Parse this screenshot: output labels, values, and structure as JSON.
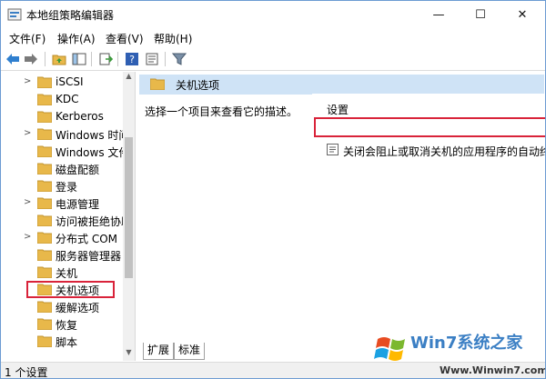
{
  "window": {
    "title": "本地组策略编辑器",
    "controls": {
      "minimize": "—",
      "maximize": "☐",
      "close": "✕"
    }
  },
  "menu": [
    "文件(F)",
    "操作(A)",
    "查看(V)",
    "帮助(H)"
  ],
  "toolbar": [
    "back-icon",
    "forward-icon",
    "up-folder-icon",
    "show-hide-tree-icon",
    "export-list-icon",
    "help-icon",
    "properties-icon",
    "filter-icon"
  ],
  "tree": {
    "items": [
      {
        "label": "iSCSI",
        "expandable": true
      },
      {
        "label": "KDC",
        "expandable": false
      },
      {
        "label": "Kerberos",
        "expandable": false
      },
      {
        "label": "Windows 时间",
        "expandable": true
      },
      {
        "label": "Windows 文件",
        "expandable": false
      },
      {
        "label": "磁盘配额",
        "expandable": false
      },
      {
        "label": "登录",
        "expandable": false
      },
      {
        "label": "电源管理",
        "expandable": true
      },
      {
        "label": "访问被拒绝协助",
        "expandable": false
      },
      {
        "label": "分布式 COM",
        "expandable": true
      },
      {
        "label": "服务器管理器",
        "expandable": false
      },
      {
        "label": "关机",
        "expandable": false
      },
      {
        "label": "关机选项",
        "expandable": false,
        "selected": true
      },
      {
        "label": "缓解选项",
        "expandable": false
      },
      {
        "label": "恢复",
        "expandable": false
      },
      {
        "label": "脚本",
        "expandable": false
      }
    ]
  },
  "pane": {
    "title": "关机选项",
    "description": "选择一个项目来查看它的描述。",
    "column_header": "设置",
    "rows": [
      "关闭会阻止或取消关机的应用程序的自动终止"
    ]
  },
  "tabs": [
    "扩展",
    "标准"
  ],
  "status": "1 个设置",
  "watermark": {
    "brand": "Win7系统之家",
    "url": "Www.Winwin7.com"
  },
  "colors": {
    "highlight_box": "#d9233a",
    "pane_header": "#cfe3f6",
    "folder": "#e8b84a"
  }
}
